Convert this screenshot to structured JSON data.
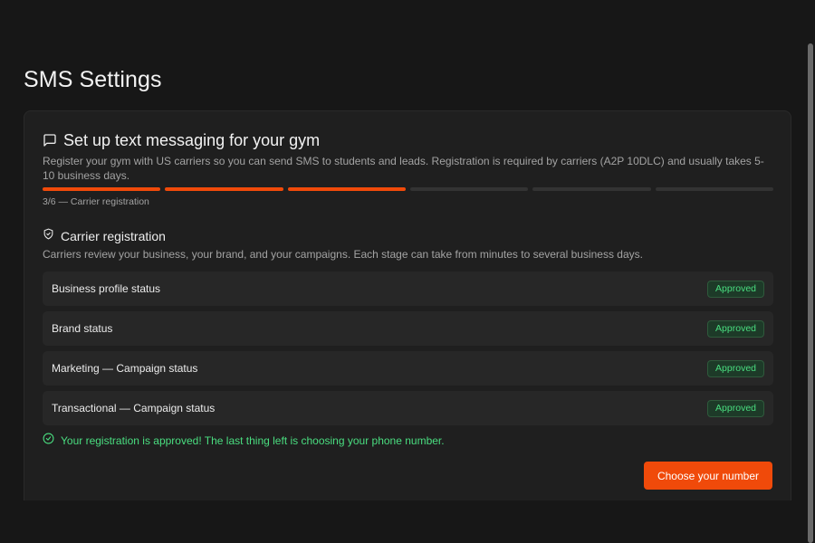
{
  "page": {
    "title": "SMS Settings"
  },
  "setup": {
    "title": "Set up text messaging for your gym",
    "description": "Register your gym with US carriers so you can send SMS to students and leads. Registration is required by carriers (A2P 10DLC) and usually takes 5-10 business days.",
    "progress": {
      "current": 3,
      "total": 6,
      "label": "3/6 — Carrier registration"
    }
  },
  "carrier": {
    "title": "Carrier registration",
    "description": "Carriers review your business, your brand, and your campaigns. Each stage can take from minutes to several business days.",
    "statuses": [
      {
        "label": "Business profile status",
        "status": "Approved"
      },
      {
        "label": "Brand status",
        "status": "Approved"
      },
      {
        "label": "Marketing — Campaign status",
        "status": "Approved"
      },
      {
        "label": "Transactional — Campaign status",
        "status": "Approved"
      }
    ],
    "success_message": "Your registration is approved! The last thing left is choosing your phone number."
  },
  "actions": {
    "choose_number_label": "Choose your number"
  },
  "colors": {
    "accent": "#f04a0a",
    "success": "#4ade80",
    "background": "#171717",
    "card": "#1f1f1f"
  },
  "icons": {
    "setup": "message-square-icon",
    "carrier": "shield-check-icon",
    "success": "check-circle-icon"
  }
}
